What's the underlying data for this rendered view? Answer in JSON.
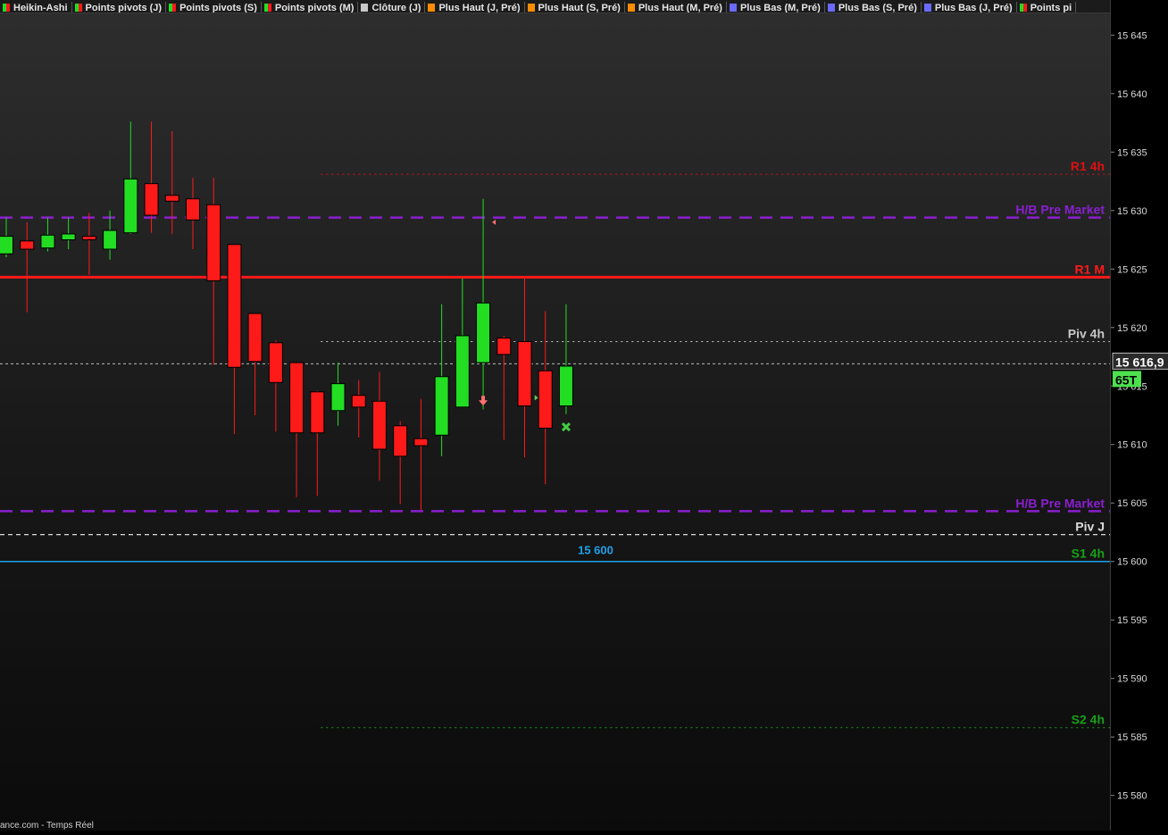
{
  "legend": [
    {
      "label": "Heikin-Ashi",
      "swatch": "split-green-red"
    },
    {
      "label": "Points pivots (J)",
      "swatch": "split-green-red"
    },
    {
      "label": "Points pivots (S)",
      "swatch": "split-green-red"
    },
    {
      "label": "Points pivots (M)",
      "swatch": "split-green-red"
    },
    {
      "label": "Clôture (J)",
      "swatch": "#c8c8c8"
    },
    {
      "label": "Plus Haut (J, Pré)",
      "swatch": "#ff8c00"
    },
    {
      "label": "Plus Haut (S, Pré)",
      "swatch": "#ff8c00"
    },
    {
      "label": "Plus Haut (M, Pré)",
      "swatch": "#ff8c00"
    },
    {
      "label": "Plus Bas (M, Pré)",
      "swatch": "#6a6aff"
    },
    {
      "label": "Plus Bas (S, Pré)",
      "swatch": "#6a6aff"
    },
    {
      "label": "Plus Bas (J, Pré)",
      "swatch": "#6a6aff"
    },
    {
      "label": "Points pi",
      "swatch": "split-green-red"
    }
  ],
  "footer": "ance.com - Temps Réel",
  "colors": {
    "up": "#22dd22",
    "down": "#ff1a1a"
  },
  "chart_data": {
    "type": "candlestick",
    "ylim": [
      15577,
      15648
    ],
    "y_ticks": [
      "15 580",
      "15 585",
      "15 590",
      "15 595",
      "15 600",
      "15 605",
      "15 610",
      "15 615",
      "15 620",
      "15 625",
      "15 630",
      "15 635",
      "15 640",
      "15 645"
    ],
    "y_tick_values": [
      15580,
      15585,
      15590,
      15595,
      15600,
      15605,
      15610,
      15615,
      15620,
      15625,
      15630,
      15635,
      15640,
      15645
    ],
    "candles": [
      {
        "open": 15626.3,
        "close": 15627.8,
        "high": 15629.4,
        "low": 15626.0
      },
      {
        "open": 15627.4,
        "close": 15626.7,
        "high": 15629.0,
        "low": 15621.3
      },
      {
        "open": 15626.8,
        "close": 15627.9,
        "high": 15629.4,
        "low": 15626.5
      },
      {
        "open": 15627.5,
        "close": 15628.0,
        "high": 15629.4,
        "low": 15626.7
      },
      {
        "open": 15627.8,
        "close": 15627.5,
        "high": 15629.8,
        "low": 15624.5
      },
      {
        "open": 15626.7,
        "close": 15628.3,
        "high": 15630.0,
        "low": 15625.8
      },
      {
        "open": 15628.1,
        "close": 15632.7,
        "high": 15637.6,
        "low": 15628.0
      },
      {
        "open": 15632.3,
        "close": 15629.6,
        "high": 15637.6,
        "low": 15628.1
      },
      {
        "open": 15631.3,
        "close": 15630.8,
        "high": 15636.8,
        "low": 15628.0
      },
      {
        "open": 15631.0,
        "close": 15629.2,
        "high": 15632.8,
        "low": 15626.7
      },
      {
        "open": 15630.5,
        "close": 15624.0,
        "high": 15632.8,
        "low": 15616.8
      },
      {
        "open": 15627.1,
        "close": 15616.6,
        "high": 15627.1,
        "low": 15610.9
      },
      {
        "open": 15621.2,
        "close": 15617.1,
        "high": 15621.2,
        "low": 15612.5
      },
      {
        "open": 15618.7,
        "close": 15615.3,
        "high": 15618.9,
        "low": 15611.1
      },
      {
        "open": 15617.0,
        "close": 15611.0,
        "high": 15617.0,
        "low": 15605.5
      },
      {
        "open": 15614.5,
        "close": 15611.0,
        "high": 15614.6,
        "low": 15605.6
      },
      {
        "open": 15612.9,
        "close": 15615.2,
        "high": 15617.0,
        "low": 15611.6
      },
      {
        "open": 15614.2,
        "close": 15613.2,
        "high": 15615.5,
        "low": 15610.6
      },
      {
        "open": 15613.7,
        "close": 15609.6,
        "high": 15616.2,
        "low": 15606.9
      },
      {
        "open": 15611.6,
        "close": 15609.0,
        "high": 15612.0,
        "low": 15604.9
      },
      {
        "open": 15610.5,
        "close": 15609.9,
        "high": 15613.9,
        "low": 15604.4
      },
      {
        "open": 15610.8,
        "close": 15615.8,
        "high": 15622.0,
        "low": 15609.0
      },
      {
        "open": 15613.2,
        "close": 15619.3,
        "high": 15624.2,
        "low": 15613.2
      },
      {
        "open": 15617.0,
        "close": 15622.1,
        "high": 15631.0,
        "low": 15613.0
      },
      {
        "open": 15619.1,
        "close": 15617.7,
        "high": 15619.3,
        "low": 15610.4
      },
      {
        "open": 15618.8,
        "close": 15613.3,
        "high": 15624.2,
        "low": 15608.9
      },
      {
        "open": 15616.3,
        "close": 15611.4,
        "high": 15621.4,
        "low": 15606.6
      },
      {
        "open": 15613.3,
        "close": 15616.7,
        "high": 15622.0,
        "low": 15612.6
      }
    ],
    "levels": [
      {
        "label": "R1 4h",
        "value": 15633.1,
        "color": "#e01010",
        "style": "dotted",
        "from": 15
      },
      {
        "label": "H/B Pre Market",
        "value": 15629.4,
        "color": "#8a1fd0",
        "style": "dashed",
        "from": 0
      },
      {
        "label": "R1 M",
        "value": 15624.3,
        "color": "#ff1a1a",
        "style": "solid",
        "from": 0
      },
      {
        "label": "Piv 4h",
        "value": 15618.8,
        "color": "#c8c8c8",
        "style": "dotted",
        "from": 15
      },
      {
        "label": "H/B Pre Market",
        "value": 15604.3,
        "color": "#8a1fd0",
        "style": "dashed",
        "from": 0
      },
      {
        "label": "Piv J",
        "value": 15602.3,
        "color": "#dcdcdc",
        "style": "dashed",
        "from": 0
      },
      {
        "label": "S1 4h",
        "value": 15600.0,
        "color": "#18a018",
        "style": "dotted",
        "from": 15
      },
      {
        "label": "S2 4h",
        "value": 15585.8,
        "color": "#18a018",
        "style": "dotted",
        "from": 15
      }
    ],
    "horizontal_line": {
      "label": "15 600",
      "value": 15600.0,
      "color": "#1ea0e8"
    },
    "last_price": {
      "label": "15 616,9",
      "value": 15616.9
    },
    "last_price_badge": {
      "label": "65T",
      "color": "#4ee14e"
    },
    "markers": [
      {
        "type": "arrow-down",
        "candle": 23,
        "value": 15613.7,
        "color": "#ff7070"
      },
      {
        "type": "triangle-left",
        "candle": 23,
        "value": 15629.0,
        "color": "#ff7070"
      },
      {
        "type": "triangle-right",
        "candle": 26,
        "value": 15614.0,
        "color": "#66cc66"
      },
      {
        "type": "cross",
        "candle": 27,
        "value": 15611.5,
        "color": "#44cc44"
      }
    ]
  }
}
